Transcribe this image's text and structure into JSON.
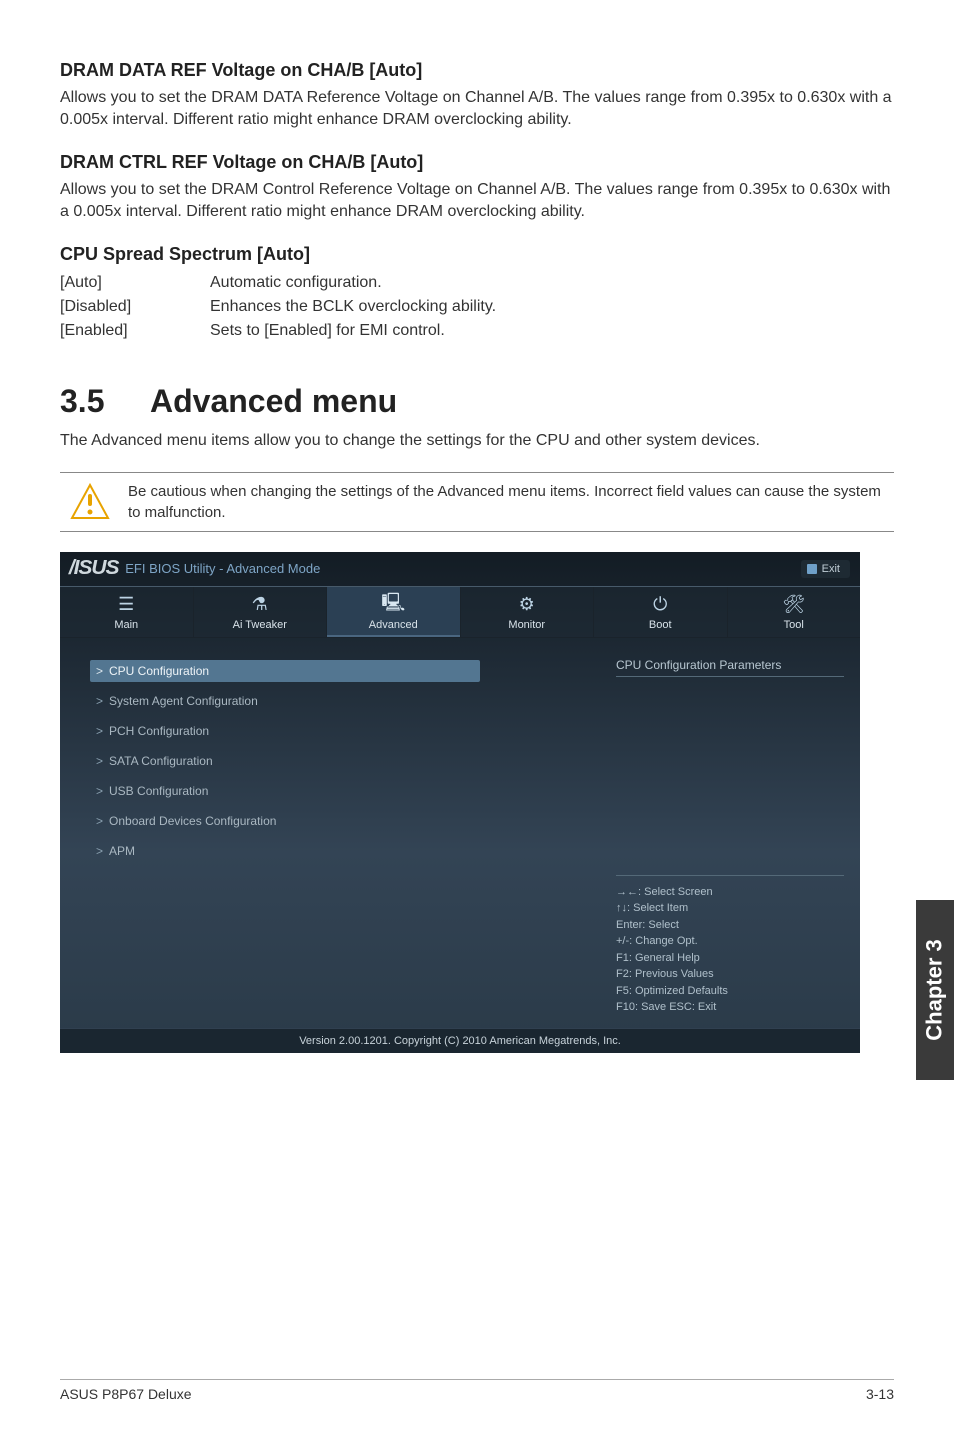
{
  "doc": {
    "s1_title": "DRAM DATA REF Voltage on CHA/B [Auto]",
    "s1_body": "Allows you to set the DRAM DATA Reference Voltage on Channel A/B. The values range from 0.395x to 0.630x with a 0.005x interval. Different ratio might enhance DRAM overclocking ability.",
    "s2_title": "DRAM CTRL REF Voltage on CHA/B [Auto]",
    "s2_body": "Allows you to set the DRAM Control Reference Voltage on Channel A/B. The values range from 0.395x to 0.630x with a 0.005x interval. Different ratio might enhance DRAM overclocking ability.",
    "s3_title": "CPU Spread Spectrum [Auto]",
    "s3_opts": [
      {
        "label": "[Auto]",
        "desc": "Automatic configuration."
      },
      {
        "label": "[Disabled]",
        "desc": "Enhances the BCLK overclocking ability."
      },
      {
        "label": "[Enabled]",
        "desc": "Sets to [Enabled] for EMI control."
      }
    ],
    "main_heading_num": "3.5",
    "main_heading_text": "Advanced menu",
    "main_body": "The Advanced menu items allow you to change the settings for the CPU and other system devices.",
    "note_text": "Be cautious when changing the settings of the Advanced menu items. Incorrect field values can cause the system to malfunction."
  },
  "bios": {
    "logo": "/ISUS",
    "title": "EFI BIOS Utility - Advanced Mode",
    "exit_label": "Exit",
    "tabs": [
      {
        "label": "Main",
        "glyph": "☰"
      },
      {
        "label": "Ai Tweaker",
        "glyph": "⚗"
      },
      {
        "label": "Advanced",
        "glyph": "🖳"
      },
      {
        "label": "Monitor",
        "glyph": "⚙"
      },
      {
        "label": "Boot",
        "glyph": "⏻"
      },
      {
        "label": "Tool",
        "glyph": "🛠"
      }
    ],
    "active_tab_index": 2,
    "menu_items": [
      "CPU Configuration",
      "System Agent Configuration",
      "PCH Configuration",
      "SATA Configuration",
      "USB Configuration",
      "Onboard Devices Configuration",
      "APM"
    ],
    "selected_menu_index": 0,
    "right_header": "CPU Configuration Parameters",
    "help_keys": [
      "→←: Select Screen",
      "↑↓: Select Item",
      "Enter: Select",
      "+/-: Change Opt.",
      "F1: General Help",
      "F2: Previous Values",
      "F5: Optimized Defaults",
      "F10: Save   ESC: Exit"
    ],
    "footer": "Version 2.00.1201.  Copyright (C) 2010 American Megatrends, Inc."
  },
  "side_tab": "Chapter 3",
  "footer_left": "ASUS P8P67 Deluxe",
  "footer_right": "3-13"
}
